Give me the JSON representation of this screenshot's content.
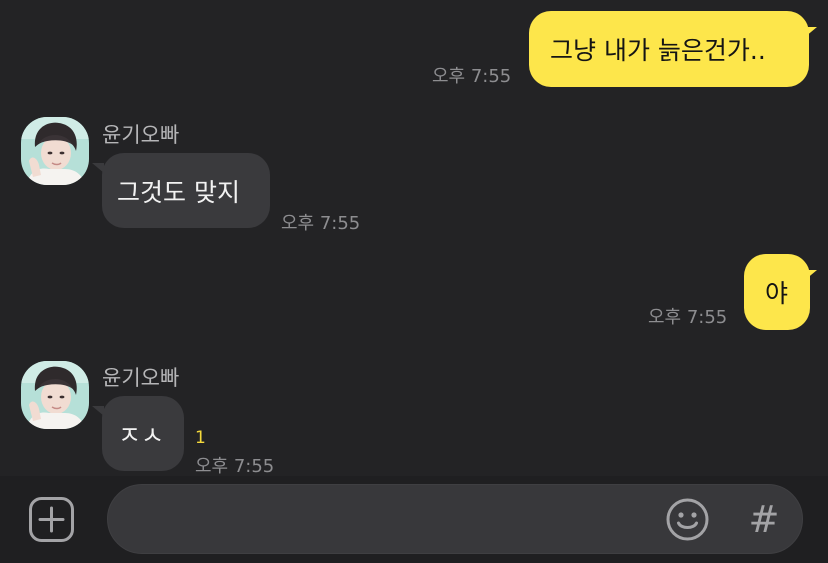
{
  "messages": [
    {
      "direction": "out",
      "text": "그냥 내가 늙은건가..",
      "time": "오후 7:55"
    },
    {
      "direction": "in",
      "sender": "윤기오빠",
      "text": "그것도 맞지",
      "time": "오후 7:55"
    },
    {
      "direction": "out",
      "text": "야",
      "time": "오후 7:55"
    },
    {
      "direction": "in",
      "sender": "윤기오빠",
      "text": "ㅈㅅ",
      "time": "오후 7:55",
      "unread": "1"
    }
  ],
  "input_bar": {
    "placeholder": "",
    "plus_icon": "plus-icon",
    "emoji_icon": "smiley-icon",
    "hash_icon": "hash-icon",
    "hash_glyph": "#"
  },
  "colors": {
    "background": "#232325",
    "outgoing_bubble": "#fde64b",
    "incoming_bubble": "#3a3a3d",
    "unread_count": "#f5d93c"
  }
}
